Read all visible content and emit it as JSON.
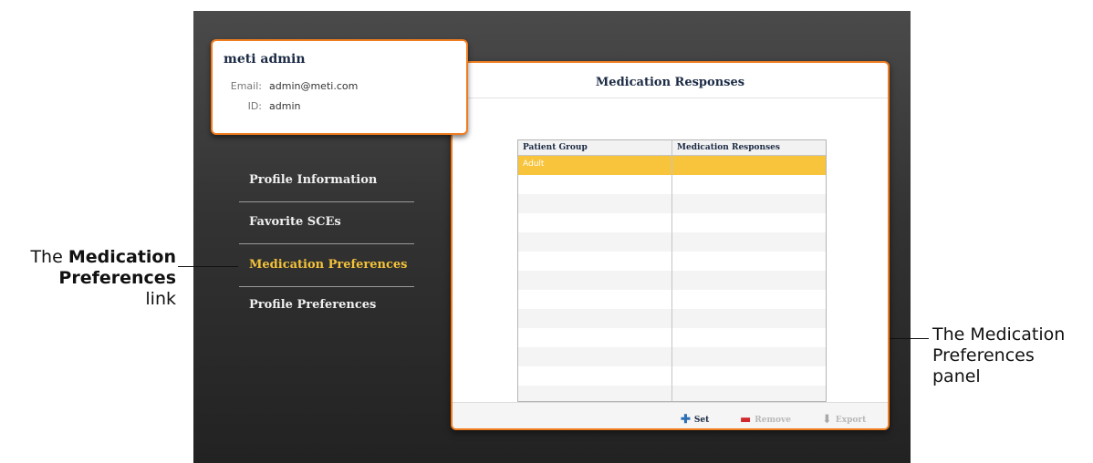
{
  "profile": {
    "name": "meti admin",
    "email_label": "Email:",
    "email": "admin@meti.com",
    "id_label": "ID:",
    "id": "admin"
  },
  "nav": {
    "items": [
      {
        "label": "Profile Information"
      },
      {
        "label": "Favorite SCEs"
      },
      {
        "label": "Medication Preferences"
      },
      {
        "label": "Profile Preferences"
      }
    ],
    "active_index": 2
  },
  "panel": {
    "title": "Medication Responses",
    "columns": [
      "Patient Group",
      "Medication Responses"
    ],
    "rows": [
      {
        "group": "Adult",
        "responses": ""
      }
    ],
    "selected_row": 0,
    "buttons": {
      "set": "Set",
      "remove": "Remove",
      "export": "Export"
    }
  },
  "callouts": {
    "left_prefix": "The ",
    "left_bold_1": "Medication",
    "left_bold_2": "Preferences",
    "left_suffix": "link",
    "right_line1": "The Medication",
    "right_line2": "Preferences",
    "right_line3": "panel"
  },
  "colors": {
    "accent": "#f07d20",
    "selection": "#f7c43c",
    "active_nav": "#f2c23a",
    "set_icon": "#2f6fb5",
    "remove_icon": "#d0282e"
  }
}
